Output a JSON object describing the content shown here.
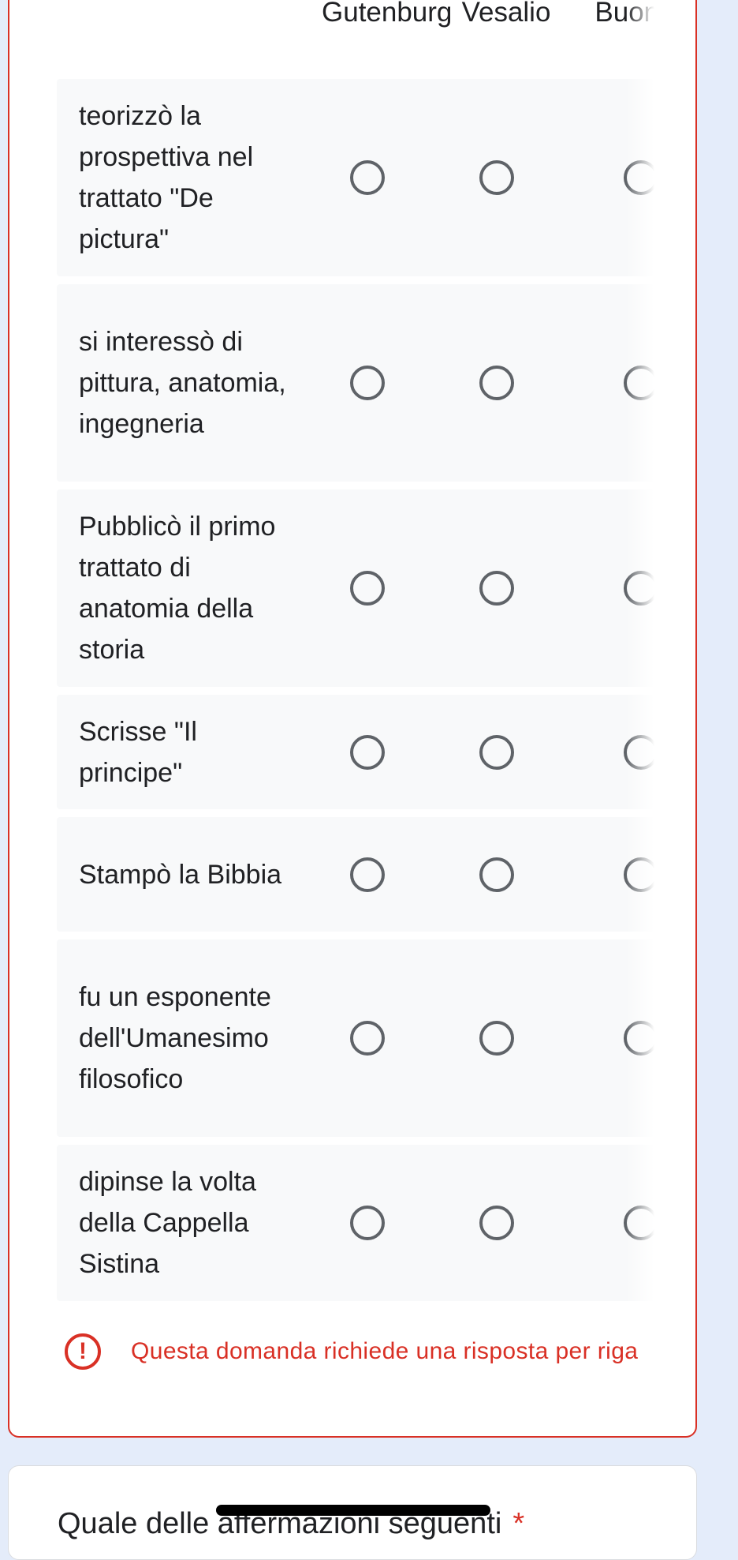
{
  "grid": {
    "columns": [
      "Gutenburg",
      "Vesalio",
      "Buona"
    ],
    "rows": [
      "teorizzò la prospettiva nel trattato \"De pictura\"",
      "si interessò di pittura, anatomia, ingegneria",
      "Pubblicò il primo trattato di anatomia della storia",
      "Scrisse \"Il principe\"",
      "Stampò la Bibbia",
      "fu un esponente dell'Umanesimo filosofico",
      "dipinse la volta della Cappella Sistina"
    ]
  },
  "error": {
    "icon": "exclamation-circle-icon",
    "message": "Questa domanda richiede una risposta per riga"
  },
  "next_question": {
    "title": "Quale delle affermazioni seguenti",
    "required_mark": "*"
  },
  "colors": {
    "accent_error": "#d93025",
    "page_background": "#e4ecfa",
    "row_background": "#f8f9fa",
    "radio_border": "#5f6368"
  }
}
